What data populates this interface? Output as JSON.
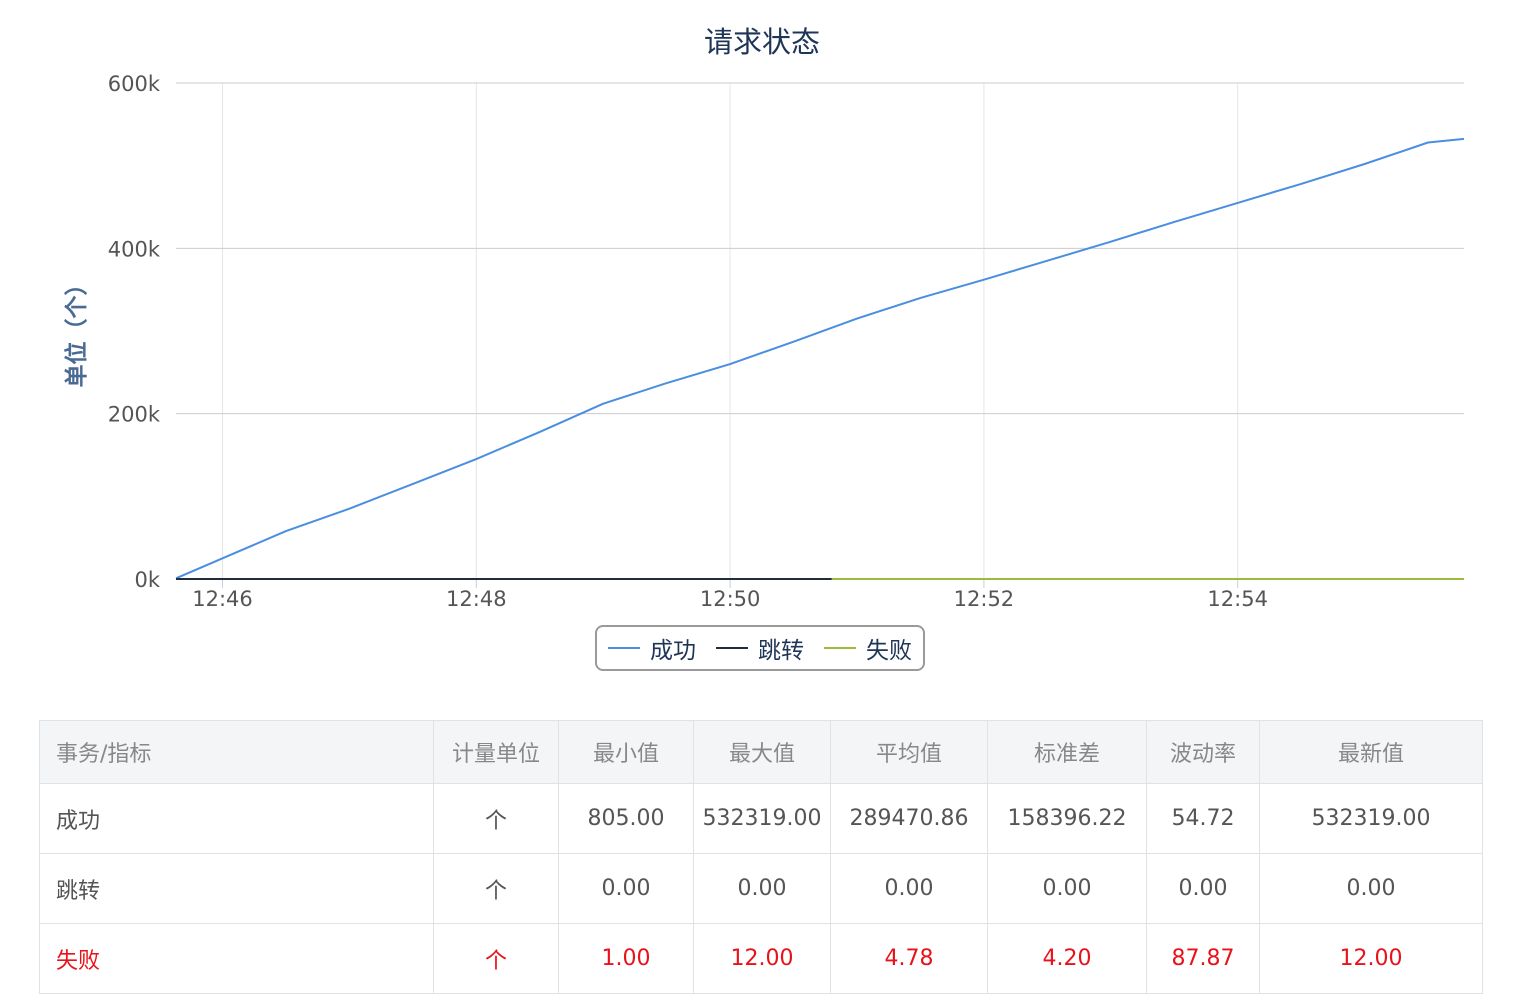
{
  "chart_data": {
    "type": "line",
    "title": "请求状态",
    "ylabel": "单位（个）",
    "xlabel": "",
    "ylim": [
      0,
      600000
    ],
    "yticks": [
      0,
      200000,
      400000,
      600000
    ],
    "ytick_labels": [
      "0k",
      "200k",
      "400k",
      "600k"
    ],
    "xlim": [
      "12:45:38",
      "12:55:47"
    ],
    "xticks": [
      "12:46",
      "12:48",
      "12:50",
      "12:52",
      "12:54"
    ],
    "grid": true,
    "legend_placement": "bottom-center",
    "series": [
      {
        "name": "成功",
        "color": "#4a8fdf",
        "x": [
          "12:45:38",
          "12:46:00",
          "12:46:30",
          "12:47:00",
          "12:47:30",
          "12:48:00",
          "12:48:30",
          "12:49:00",
          "12:49:30",
          "12:50:00",
          "12:50:30",
          "12:51:00",
          "12:51:30",
          "12:52:00",
          "12:52:30",
          "12:53:00",
          "12:53:30",
          "12:54:00",
          "12:54:30",
          "12:55:00",
          "12:55:30",
          "12:55:47"
        ],
        "y": [
          805,
          25000,
          58000,
          85000,
          115000,
          145000,
          178000,
          212000,
          237000,
          260000,
          287000,
          315000,
          340000,
          362000,
          385000,
          408000,
          432000,
          455000,
          478000,
          502000,
          528000,
          532319
        ]
      },
      {
        "name": "跳转",
        "color": "#1f2d3d",
        "x": [
          "12:45:38",
          "12:55:47"
        ],
        "y": [
          0,
          0
        ]
      },
      {
        "name": "失败",
        "color": "#9bbb3b",
        "x": [
          "12:50:48",
          "12:55:47"
        ],
        "y": [
          1,
          12
        ]
      }
    ]
  },
  "table": {
    "headers": [
      "事务/指标",
      "计量单位",
      "最小值",
      "最大值",
      "平均值",
      "标准差",
      "波动率",
      "最新值"
    ],
    "rows": [
      [
        "成功",
        "个",
        "805.00",
        "532319.00",
        "289470.86",
        "158396.22",
        "54.72",
        "532319.00"
      ],
      [
        "跳转",
        "个",
        "0.00",
        "0.00",
        "0.00",
        "0.00",
        "0.00",
        "0.00"
      ],
      [
        "失败",
        "个",
        "1.00",
        "12.00",
        "4.78",
        "4.20",
        "87.87",
        "12.00"
      ]
    ],
    "highlight_color": "#e8121b"
  }
}
